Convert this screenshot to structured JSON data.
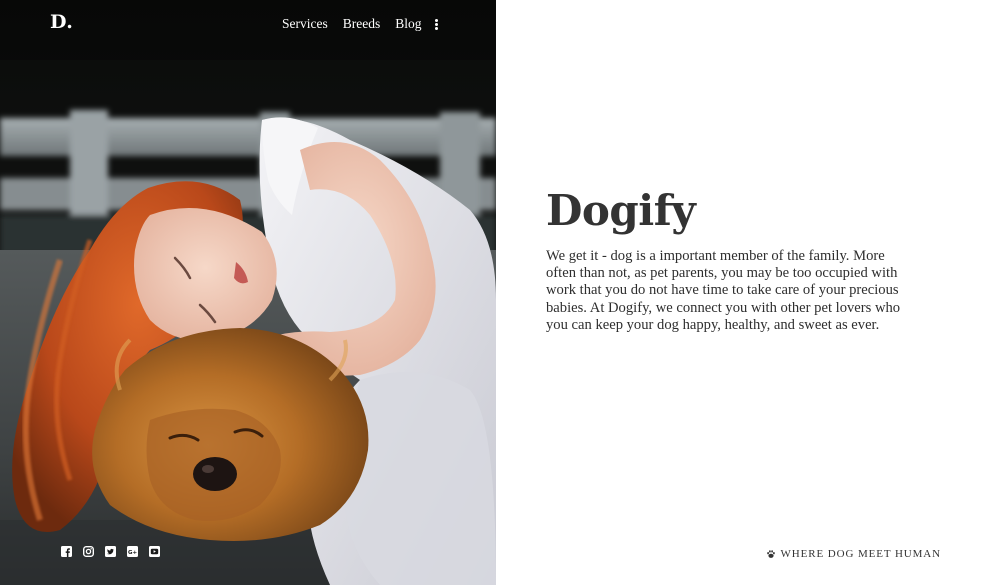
{
  "header": {
    "brand": "D.",
    "nav": [
      {
        "label": "Services"
      },
      {
        "label": "Breeds"
      },
      {
        "label": "Blog"
      }
    ],
    "menu_icon": "kebab-menu-icon"
  },
  "hero": {
    "image": "photo of red-haired girl in white dress sleeping on a fluffy golden dog",
    "socials": [
      {
        "icon": "facebook-icon"
      },
      {
        "icon": "instagram-icon"
      },
      {
        "icon": "twitter-icon"
      },
      {
        "icon": "google-plus-icon"
      },
      {
        "icon": "youtube-icon"
      }
    ]
  },
  "main": {
    "title": "Dogify",
    "description": "We get it - dog is a important member of the family. More often than not, as pet parents, you may be too occupied with work that you do not have time to take care of your precious babies. At Dogify, we connect you with other pet lovers who you can keep your dog happy, healthy, and sweet as ever."
  },
  "footer": {
    "tagline": "WHERE DOG MEET HUMAN",
    "tagline_icon": "paw-icon"
  },
  "colors": {
    "text": "#333333",
    "hero_dark": "#0d0e0d",
    "hair": "#c2511d",
    "dog_fur": "#c47b30",
    "dress": "#e6e6ea"
  }
}
